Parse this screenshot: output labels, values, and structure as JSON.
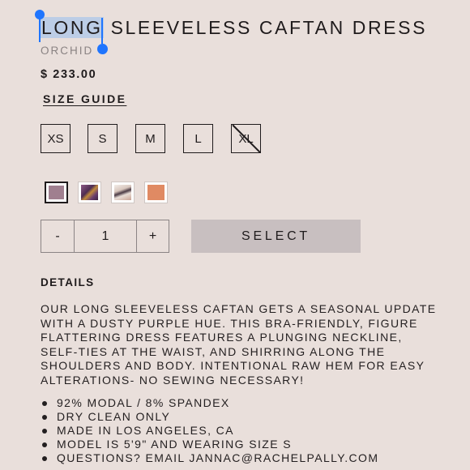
{
  "product": {
    "title_selected": "LONG",
    "title_rest": " SLEEVELESS CAFTAN DRESS",
    "color_name": "ORCHID",
    "price": "$ 233.00",
    "size_guide": "SIZE GUIDE"
  },
  "sizes": [
    {
      "label": "XS",
      "available": true
    },
    {
      "label": "S",
      "available": true
    },
    {
      "label": "M",
      "available": true
    },
    {
      "label": "L",
      "available": true
    },
    {
      "label": "XL",
      "available": false
    }
  ],
  "swatches": [
    {
      "name": "orchid",
      "color": "#a07f8f",
      "selected": true
    },
    {
      "name": "purple-print",
      "color": "#6b3f6f",
      "selected": false
    },
    {
      "name": "white-print",
      "color": "#d9cfc8",
      "selected": false
    },
    {
      "name": "coral",
      "color": "#e08a63",
      "selected": false
    }
  ],
  "quantity": {
    "minus": "-",
    "value": "1",
    "plus": "+"
  },
  "select_button": "SELECT",
  "details": {
    "heading": "DETAILS",
    "description": "OUR LONG SLEEVELESS CAFTAN GETS A SEASONAL UPDATE WITH A DUSTY PURPLE HUE. THIS BRA-FRIENDLY, FIGURE FLATTERING DRESS FEATURES A PLUNGING NECKLINE, SELF-TIES AT THE WAIST, AND SHIRRING ALONG THE SHOULDERS AND BODY. INTENTIONAL RAW HEM FOR EASY ALTERATIONS- NO SEWING NECESSARY!",
    "bullets": [
      "92% MODAL / 8% SPANDEX",
      "DRY CLEAN ONLY",
      "MADE IN LOS ANGELES, CA",
      "MODEL IS 5'9\" AND WEARING SIZE S",
      "QUESTIONS? EMAIL JANNAC@RACHELPALLY.COM"
    ]
  },
  "colors": {
    "background": "#e9dfdb",
    "text": "#1f1b1c",
    "selection_highlight": "#bccde6",
    "selection_handle": "#1f75fe",
    "select_button_bg": "#c8bfc0",
    "muted_text": "#8a8383"
  }
}
